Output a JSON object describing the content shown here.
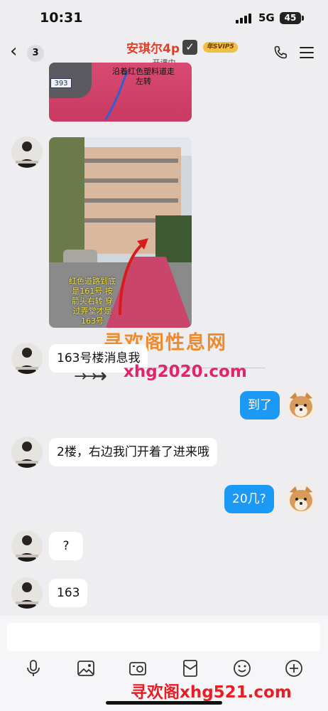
{
  "status_bar": {
    "time": "10:31",
    "network": "5G",
    "battery": "45"
  },
  "header": {
    "back_icon": "chevron-left-icon",
    "unread_count": "3",
    "title": "安琪尔4p",
    "svip_badge": "年SVIP5",
    "subtitle": "开课中",
    "phone_icon": "phone-icon",
    "menu_icon": "menu-icon"
  },
  "messages": [
    {
      "type": "image",
      "from": "contact",
      "caption": "沿着红色塑料道走左转"
    },
    {
      "type": "image",
      "from": "contact",
      "caption": "红色道路到底是161号 按箭头右转 穿过弄堂才是163号"
    },
    {
      "type": "text",
      "from": "contact",
      "text": "163号楼消息我"
    },
    {
      "type": "text",
      "from": "me",
      "text": "到了"
    },
    {
      "type": "text",
      "from": "contact",
      "text": "2楼，右边我门开着了进来哦"
    },
    {
      "type": "text",
      "from": "me",
      "text": "20几?"
    },
    {
      "type": "text",
      "from": "contact",
      "text": "?"
    },
    {
      "type": "text",
      "from": "contact",
      "text": "163"
    }
  ],
  "watermarks": {
    "site_name": "寻欢阁性息网",
    "site_url": "xhg2020.com",
    "bottom": "寻欢阁xhg521.com"
  },
  "input": {
    "placeholder": ""
  },
  "toolbar": [
    "mic-icon",
    "image-icon",
    "camera-icon",
    "red-packet-icon",
    "emoji-icon",
    "plus-icon"
  ],
  "colors": {
    "title": "#e0402a",
    "outgoing_bubble": "#1c98f5",
    "background": "#eeeef0"
  }
}
